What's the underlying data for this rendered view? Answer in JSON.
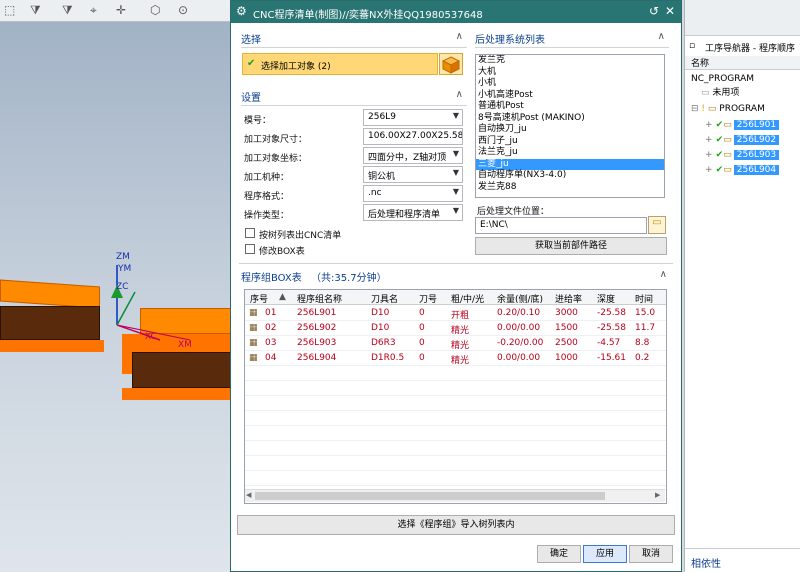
{
  "dialog": {
    "title": "CNC程序清单(制图)//奕蕃NX外挂QQ1980537648",
    "sections": {
      "select": "选择",
      "settings": "设置",
      "post_list": "后处理系统列表",
      "box_table": "程序组BOX表",
      "box_total": "（共:35.7分钟）"
    },
    "select_target": "选择加工对象 (2)",
    "settings": {
      "mold_no_label": "模号：",
      "mold_no_value": "256L9",
      "size_label": "加工对象尺寸：",
      "size_value": "106.00X27.00X25.58",
      "coord_label": "加工对象坐标：",
      "coord_value": "四面分中，Z轴对顶",
      "machine_label": "加工机种：",
      "machine_value": "铜公机",
      "format_label": "程序格式：",
      "format_value": ".nc",
      "optype_label": "操作类型：",
      "optype_value": "后处理和程序清单",
      "chk_tree": "按树列表出CNC清单",
      "chk_box": "修改BOX表"
    },
    "post_items": [
      "发兰克",
      "大机",
      "小机",
      "小机高速Post",
      "普通机Post",
      "8号高速机Post (MAKINO)",
      "自动换刀_ju",
      "西门子_ju",
      "法兰克_ju",
      "三菱_ju",
      "自动程序单(NX3-4.0)",
      "发兰克88"
    ],
    "post_selected_index": 9,
    "post_file_label": "后处理文件位置：",
    "post_file_value": "E:\\NC\\",
    "get_path_button": "获取当前部件路径",
    "table": {
      "headers": [
        "序号",
        "程序组名称",
        "刀具名",
        "刀号",
        "粗/中/光",
        "余量(侧/底)",
        "进给率",
        "深度",
        "时间"
      ],
      "rows": [
        [
          "01",
          "256L901",
          "D10",
          "0",
          "开粗",
          "0.20/0.10",
          "3000",
          "-25.58",
          "15.0"
        ],
        [
          "02",
          "256L902",
          "D10",
          "0",
          "精光",
          "0.00/0.00",
          "1500",
          "-25.58",
          "11.7"
        ],
        [
          "03",
          "256L903",
          "D6R3",
          "0",
          "精光",
          "-0.20/0.00",
          "2500",
          "-4.57",
          "8.8"
        ],
        [
          "04",
          "256L904",
          "D1R0.5",
          "0",
          "精光",
          "0.00/0.00",
          "1000",
          "-15.61",
          "0.2"
        ]
      ]
    },
    "import_button": "选择《程序组》导入树列表内",
    "ok_button": "确定",
    "apply_button": "应用",
    "cancel_button": "取消"
  },
  "viewport": {
    "axes": {
      "zm": "ZM",
      "ym": "YM",
      "zc": "ZC",
      "xc": "XC",
      "xm": "XM"
    }
  },
  "navigator": {
    "title": "工序导航器 - 程序顺序",
    "col_name": "名称",
    "root": "NC_PROGRAM",
    "unused": "未用项",
    "program": "PROGRAM",
    "items": [
      "256L901",
      "256L902",
      "256L903",
      "256L904"
    ],
    "dependency": "相依性"
  }
}
